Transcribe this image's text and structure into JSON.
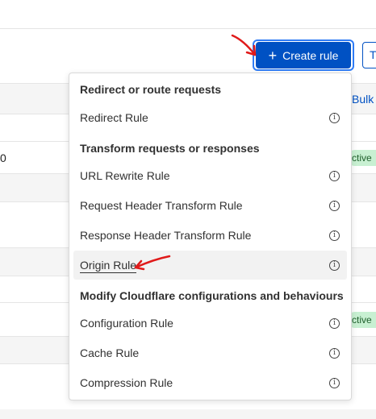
{
  "toolbar": {
    "create_rule_label": "Create rule",
    "create_rule_icon": "plus-icon",
    "second_button_label": "T",
    "bulk_link": "Bulk"
  },
  "table": {
    "row_value_fragment": "0",
    "status_badges": [
      "ctive",
      "ctive"
    ]
  },
  "menu": {
    "groups": [
      {
        "header": "Redirect or route requests",
        "items": [
          "Redirect Rule"
        ]
      },
      {
        "header": "Transform requests or responses",
        "items": [
          "URL Rewrite Rule",
          "Request Header Transform Rule",
          "Response Header Transform Rule",
          "Origin Rule"
        ]
      },
      {
        "header": "Modify Cloudflare configurations and behaviours",
        "items": [
          "Configuration Rule",
          "Cache Rule",
          "Compression Rule"
        ]
      }
    ],
    "info_icon_glyph": "i",
    "hovered_item": "Origin Rule"
  },
  "colors": {
    "primary": "#0051c3",
    "focus_ring": "#2f7cf6",
    "annotation": "#e01a1a",
    "status_bg": "#c8f0d2"
  }
}
